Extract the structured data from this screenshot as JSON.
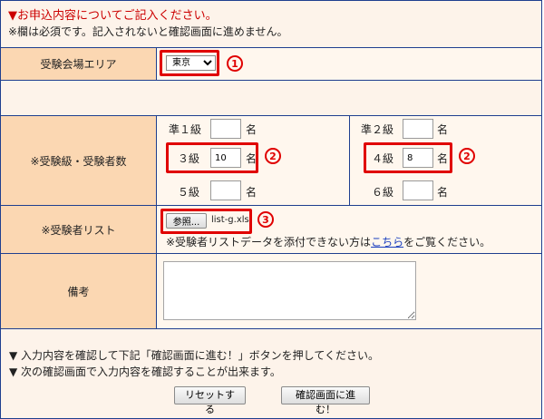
{
  "notice": {
    "title": "▼お申込内容についてご記入ください。",
    "subtitle": "※欄は必須です。記入されないと確認画面に進めません。"
  },
  "rows": {
    "area_label": "受験会場エリア",
    "grades_label": "※受験級・受験者数",
    "list_label": "※受験者リスト",
    "remarks_label": "備考"
  },
  "area": {
    "selected": "東京"
  },
  "grades": [
    {
      "label": "準１級",
      "value": "",
      "unit": "名"
    },
    {
      "label": "準２級",
      "value": "",
      "unit": "名"
    },
    {
      "label": "３級",
      "value": "10",
      "unit": "名"
    },
    {
      "label": "４級",
      "value": "8",
      "unit": "名"
    },
    {
      "label": "５級",
      "value": "",
      "unit": "名"
    },
    {
      "label": "６級",
      "value": "",
      "unit": "名"
    }
  ],
  "file": {
    "browse_label": "参照...",
    "filename": "list-g.xls",
    "note_before": "※受験者リストデータを添付できない方は",
    "note_link": "こちら",
    "note_after": "をご覧ください。"
  },
  "remarks": {
    "value": ""
  },
  "footer": {
    "line1": "▼ 入力内容を確認して下記「確認画面に進む！」ボタンを押してください。",
    "line2": "▼ 次の確認画面で入力内容を確認することが出来ます。",
    "reset_label": "リセットする",
    "confirm_label": "確認画面に進む！"
  },
  "markers": {
    "one": "1",
    "two": "2",
    "three": "3"
  },
  "colors": {
    "label_bg": "#fbd7b2",
    "value_bg": "#fff7ee",
    "border": "#1f3f8f",
    "notice_red": "#cc0000",
    "highlight_red": "#e00000",
    "link": "#1a3fbf"
  }
}
